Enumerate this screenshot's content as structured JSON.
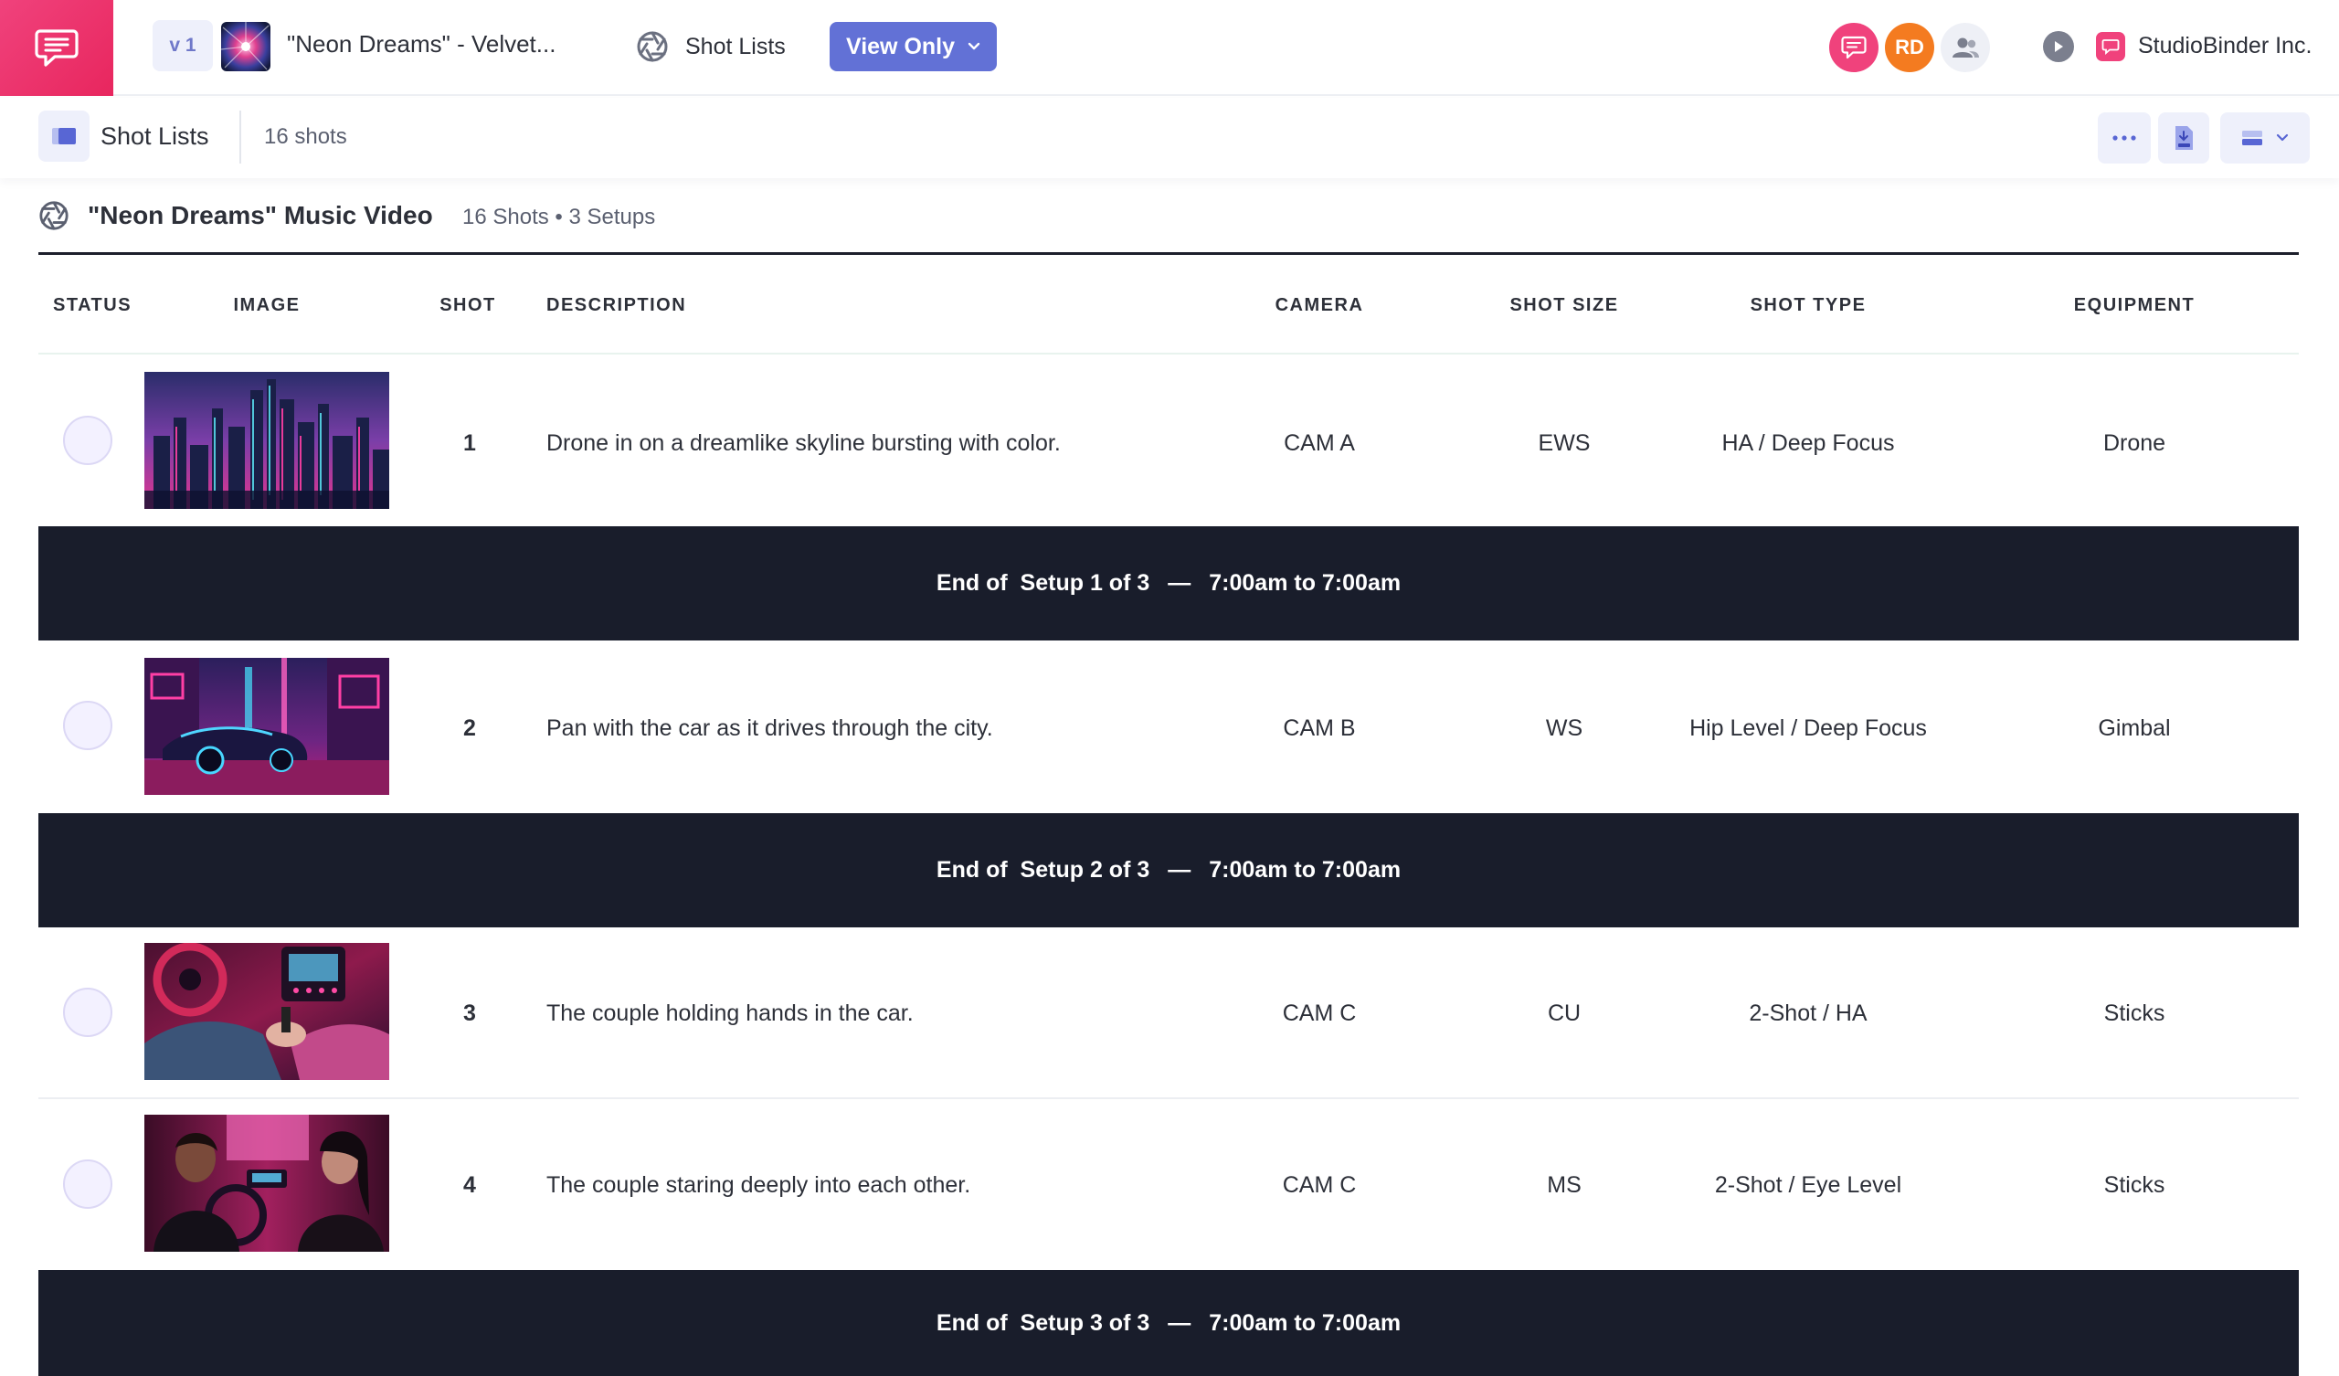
{
  "topbar": {
    "version": "v 1",
    "project_title": "\"Neon Dreams\" - Velvet...",
    "nav_label": "Shot Lists",
    "view_button": "View Only",
    "avatar_initials": "RD",
    "company": "StudioBinder Inc."
  },
  "subbar": {
    "title": "Shot Lists",
    "count": "16 shots"
  },
  "list": {
    "title": "\"Neon Dreams\" Music Video",
    "meta": "16 Shots • 3 Setups"
  },
  "columns": {
    "status": "STATUS",
    "image": "IMAGE",
    "shot": "SHOT",
    "description": "DESCRIPTION",
    "camera": "CAMERA",
    "shot_size": "SHOT SIZE",
    "shot_type": "SHOT TYPE",
    "equipment": "EQUIPMENT"
  },
  "shots": [
    {
      "shot": "1",
      "description": "Drone in on a dreamlike skyline bursting with color.",
      "camera": "CAM A",
      "shot_size": "EWS",
      "shot_type": "HA / Deep Focus",
      "equipment": "Drone",
      "image": "neon-skyline"
    },
    {
      "shot": "2",
      "description": "Pan with the car as it drives through the city.",
      "camera": "CAM B",
      "shot_size": "WS",
      "shot_type": "Hip Level / Deep Focus",
      "equipment": "Gimbal",
      "image": "neon-car-street"
    },
    {
      "shot": "3",
      "description": "The couple holding hands in the car.",
      "camera": "CAM C",
      "shot_size": "CU",
      "shot_type": "2-Shot / HA",
      "equipment": "Sticks",
      "image": "car-interior-hands"
    },
    {
      "shot": "4",
      "description": "The couple staring deeply into each other.",
      "camera": "CAM C",
      "shot_size": "MS",
      "shot_type": "2-Shot / Eye Level",
      "equipment": "Sticks",
      "image": "couple-in-car"
    }
  ],
  "setups": [
    {
      "label": "End of  Setup 1 of 3",
      "dash": "—",
      "time": "7:00am to 7:00am"
    },
    {
      "label": "End of  Setup 2 of 3",
      "dash": "—",
      "time": "7:00am to 7:00am"
    },
    {
      "label": "End of  Setup 3 of 3",
      "dash": "—",
      "time": "7:00am to 7:00am"
    }
  ],
  "colors": {
    "brand_pink": "#f0427c",
    "accent_blue": "#6271d6",
    "avatar_orange": "#f47b20",
    "setup_bar": "#191d2b"
  },
  "icons": {
    "logo": "chat-bubble-icon",
    "nav": "aperture-icon",
    "comments": "comment-icon",
    "people": "people-icon",
    "play": "play-icon",
    "more": "more-dots-icon",
    "pdf": "pdf-download-icon",
    "layout": "layout-rows-icon"
  }
}
